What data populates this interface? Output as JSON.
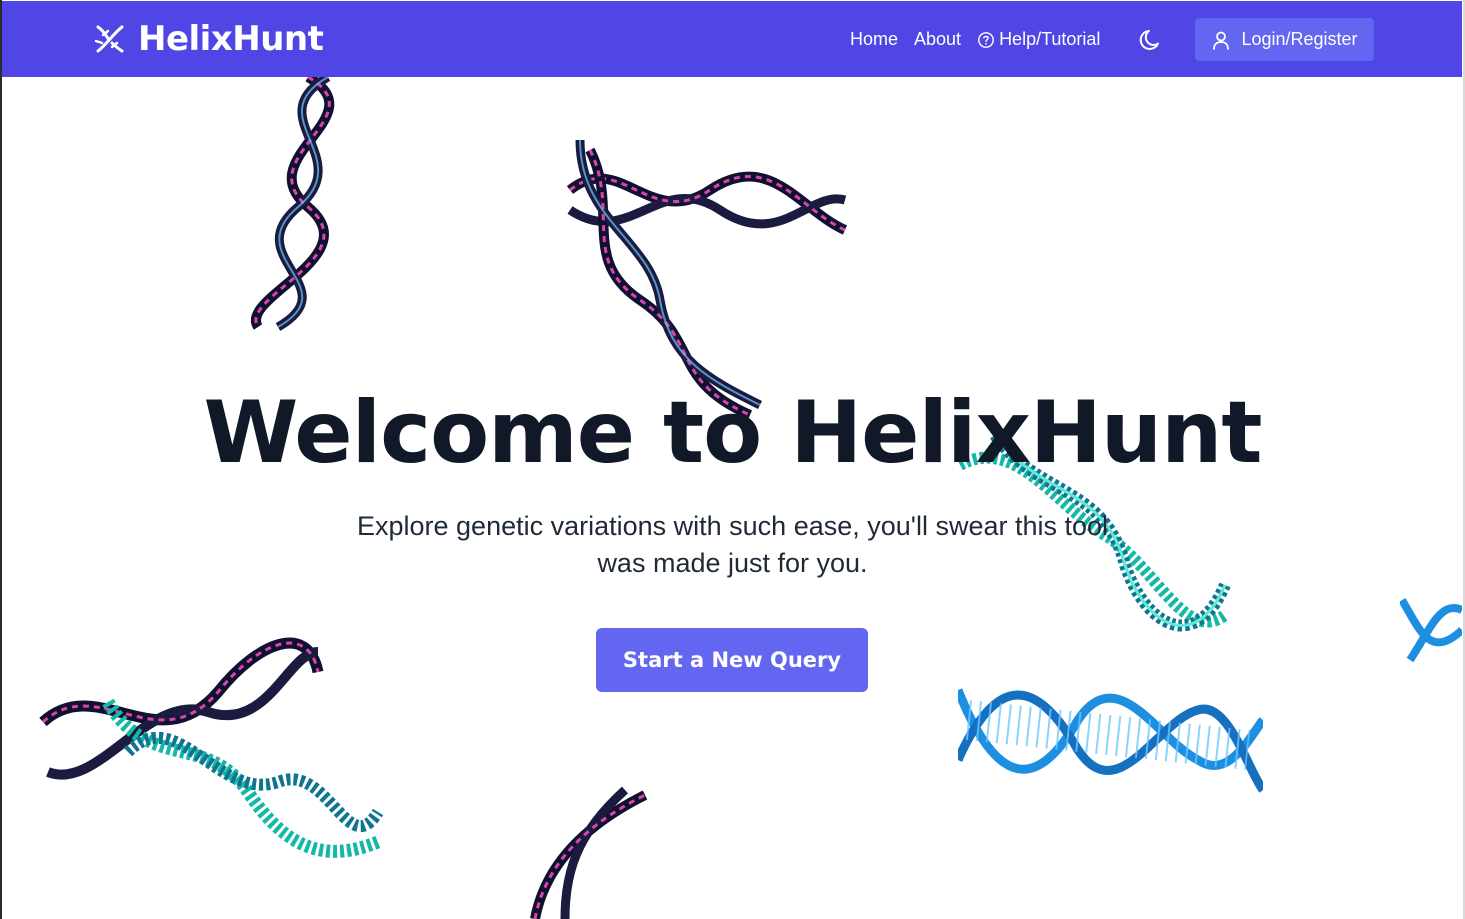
{
  "navbar": {
    "brand": "HelixHunt",
    "links": [
      {
        "label": "Home"
      },
      {
        "label": "About"
      },
      {
        "label": "Help/Tutorial"
      }
    ],
    "login_label": "Login/Register"
  },
  "hero": {
    "title": "Welcome to HelixHunt",
    "subtitle": "Explore genetic variations with such ease, you'll swear this tool was made just for you.",
    "cta_label": "Start a New Query"
  },
  "colors": {
    "nav_bg": "#4f46e5",
    "accent": "#6366f1",
    "text_dark": "#111827",
    "dna_pink": "#d946a8",
    "dna_teal": "#14b8a6",
    "dna_blue": "#1d8fe0"
  },
  "icons": [
    "dna-logo-icon",
    "help-circle-icon",
    "moon-icon",
    "user-icon"
  ]
}
